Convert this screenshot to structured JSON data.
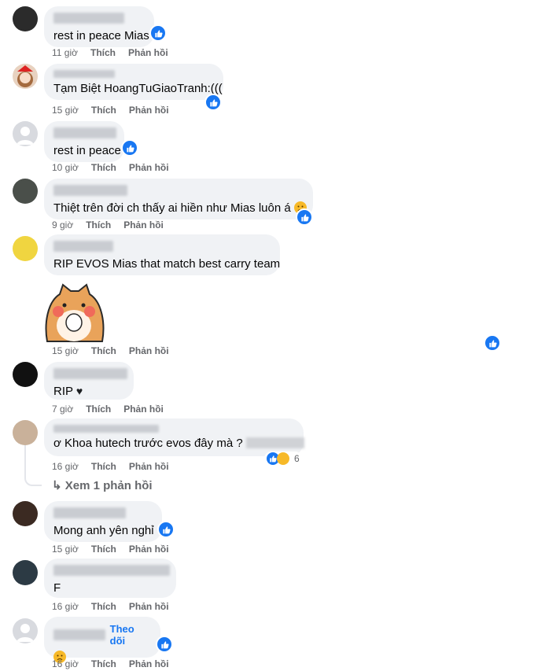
{
  "actions": {
    "like": "Thích",
    "reply": "Phản hồi"
  },
  "comments": [
    {
      "text": "rest in peace Mias",
      "time": "11 giờ"
    },
    {
      "text": "Tạm Biệt HoangTuGiaoTranh:(((",
      "time": "15 giờ"
    },
    {
      "text": "rest in peace",
      "time": "10 giờ"
    },
    {
      "text": "Thiệt trên đời ch thấy ai hiền như Mias luôn á",
      "time": "9 giờ"
    },
    {
      "text": "RIP EVOS Mias that match best carry team",
      "time": "15 giờ"
    },
    {
      "text": "RIP",
      "time": "7 giờ"
    },
    {
      "text": "ơ Khoa hutech trước evos đây mà ?",
      "time": "16 giờ",
      "reaction_count": "6"
    },
    {
      "text": "Mong anh yên nghỉ",
      "time": "15 giờ"
    },
    {
      "text": "F",
      "time": "16 giờ"
    },
    {
      "text": "",
      "time": "16 giờ",
      "follow": "Theo dõi"
    }
  ],
  "view_replies": "Xem 1 phản hồi",
  "colors": {
    "like_blue": "#1877f2",
    "bubble_bg": "#f0f2f5",
    "meta_gray": "#65676b"
  }
}
